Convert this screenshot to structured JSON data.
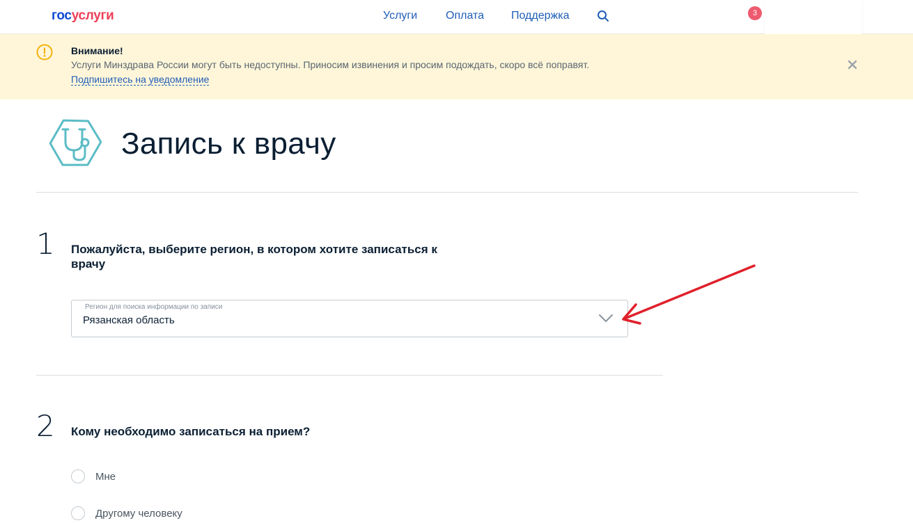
{
  "header": {
    "logo_part1": "гос",
    "logo_part2": "услуги",
    "nav": [
      "Услуги",
      "Оплата",
      "Поддержка"
    ],
    "notification_count": "3",
    "icons": {
      "search": "search-icon"
    }
  },
  "alert": {
    "title": "Внимание!",
    "text": "Услуги Минздрава России могут быть недоступны. Приносим извинения и просим подождать, скоро всё поправят.",
    "link": "Подпишитесь на уведомление",
    "icons": {
      "warning": "warning-icon",
      "close": "close-icon"
    },
    "bg_color": "#fff6d9",
    "icon_color": "#f2b20f"
  },
  "service": {
    "title": "Запись к врачу",
    "icon": "stethoscope-icon",
    "icon_color": "#5bbcc5"
  },
  "step1": {
    "number": "1",
    "question": "Пожалуйста, выберите регион, в котором хотите записаться к врачу",
    "select": {
      "label": "Регион для поиска информации по записи",
      "value": "Рязанская область"
    }
  },
  "step2": {
    "number": "2",
    "question": "Кому необходимо записаться на прием?",
    "options": [
      "Мне",
      "Другому человеку"
    ]
  },
  "colors": {
    "link": "#1f5db8",
    "badge": "#ee5a6e",
    "annotation_arrow": "#e0202a"
  }
}
